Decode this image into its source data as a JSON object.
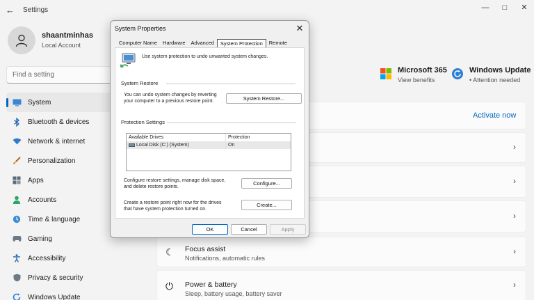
{
  "window": {
    "title": "Settings",
    "back_icon": "back-arrow-icon",
    "controls": [
      "minimize-icon",
      "maximize-icon",
      "close-icon"
    ]
  },
  "user": {
    "name": "shaantminhas",
    "account_type": "Local Account"
  },
  "search": {
    "placeholder": "Find a setting"
  },
  "nav": {
    "items": [
      {
        "label": "System",
        "icon": "monitor-icon",
        "active": true
      },
      {
        "label": "Bluetooth & devices",
        "icon": "bluetooth-icon"
      },
      {
        "label": "Network & internet",
        "icon": "wifi-icon"
      },
      {
        "label": "Personalization",
        "icon": "brush-icon"
      },
      {
        "label": "Apps",
        "icon": "apps-icon"
      },
      {
        "label": "Accounts",
        "icon": "person-icon"
      },
      {
        "label": "Time & language",
        "icon": "globe-clock-icon"
      },
      {
        "label": "Gaming",
        "icon": "gamepad-icon"
      },
      {
        "label": "Accessibility",
        "icon": "accessibility-icon"
      },
      {
        "label": "Privacy & security",
        "icon": "shield-icon"
      },
      {
        "label": "Windows Update",
        "icon": "update-icon"
      }
    ]
  },
  "tiles": {
    "m365": {
      "title": "Microsoft 365",
      "sub": "View benefits"
    },
    "update": {
      "title": "Windows Update",
      "sub": "Attention needed"
    }
  },
  "main": {
    "activate_link": "Activate now",
    "focus": {
      "title": "Focus assist",
      "sub": "Notifications, automatic rules"
    },
    "power": {
      "title": "Power & battery",
      "sub": "Sleep, battery usage, battery saver"
    }
  },
  "dialog": {
    "title": "System Properties",
    "tabs": [
      {
        "label": "Computer Name"
      },
      {
        "label": "Hardware"
      },
      {
        "label": "Advanced"
      },
      {
        "label": "System Protection",
        "active": true
      },
      {
        "label": "Remote"
      }
    ],
    "intro": "Use system protection to undo unwanted system changes.",
    "restore_group": "System Restore",
    "restore_text_1": "You can undo system changes by reverting",
    "restore_text_2": "your computer to a previous restore point.",
    "restore_button": "System Restore...",
    "protection_group": "Protection Settings",
    "drives_header": {
      "drive": "Available Drives",
      "protection": "Protection"
    },
    "drives": [
      {
        "drive": "Local Disk (C:) (System)",
        "protection": "On"
      }
    ],
    "configure_text_1": "Configure restore settings, manage disk space,",
    "configure_text_2": "and delete restore points.",
    "configure_button": "Configure...",
    "create_text_1": "Create a restore point right now for the drives",
    "create_text_2": "that have system protection turned on.",
    "create_button": "Create...",
    "ok": "OK",
    "cancel": "Cancel",
    "apply": "Apply"
  },
  "colors": {
    "accent": "#0067c0",
    "background": "#f3f3f3"
  }
}
